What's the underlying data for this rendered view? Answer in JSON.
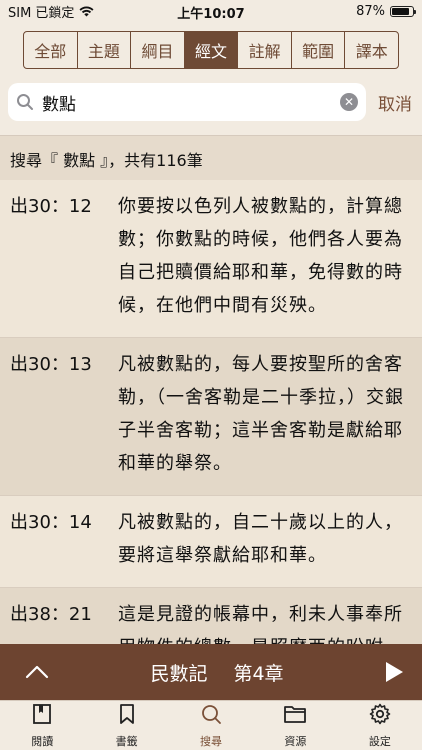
{
  "status": {
    "carrier": "SIM 已鎖定",
    "time": "上午10:07",
    "battery": "87%",
    "battery_level": 0.87
  },
  "segments": [
    {
      "label": "全部",
      "active": false
    },
    {
      "label": "主題",
      "active": false
    },
    {
      "label": "綱目",
      "active": false
    },
    {
      "label": "經文",
      "active": true
    },
    {
      "label": "註解",
      "active": false
    },
    {
      "label": "範圍",
      "active": false
    },
    {
      "label": "譯本",
      "active": false
    }
  ],
  "search": {
    "value": "數點",
    "cancel_label": "取消"
  },
  "result_header": "搜尋『 數點 』，共有116筆",
  "verses": [
    {
      "ref": "出30：12",
      "text": "你要按以色列人被數點的，計算總數；你數點的時候，他們各人要為自己把贖價給耶和華，免得數的時候，在他們中間有災殃。"
    },
    {
      "ref": "出30：13",
      "text": "凡被數點的，每人要按聖所的舍客勒，（一舍客勒是二十季拉，）交銀子半舍客勒；這半舍客勒是獻給耶和華的舉祭。"
    },
    {
      "ref": "出30：14",
      "text": "凡被數點的，自二十歲以上的人，要將這舉祭獻給耶和華。"
    },
    {
      "ref": "出38：21",
      "text": "這是見證的帳幕中，利未人事奉所用物件的總數，是照摩西的吩咐，經祭司亞倫的兒子以他瑪的"
    }
  ],
  "player": {
    "book": "民數記",
    "chapter": "第4章"
  },
  "tabs": [
    {
      "label": "閱讀",
      "icon": "book-icon",
      "active": false
    },
    {
      "label": "書籤",
      "icon": "bookmark-icon",
      "active": false
    },
    {
      "label": "搜尋",
      "icon": "search-icon",
      "active": true
    },
    {
      "label": "資源",
      "icon": "folder-icon",
      "active": false
    },
    {
      "label": "設定",
      "icon": "gear-icon",
      "active": false
    }
  ]
}
